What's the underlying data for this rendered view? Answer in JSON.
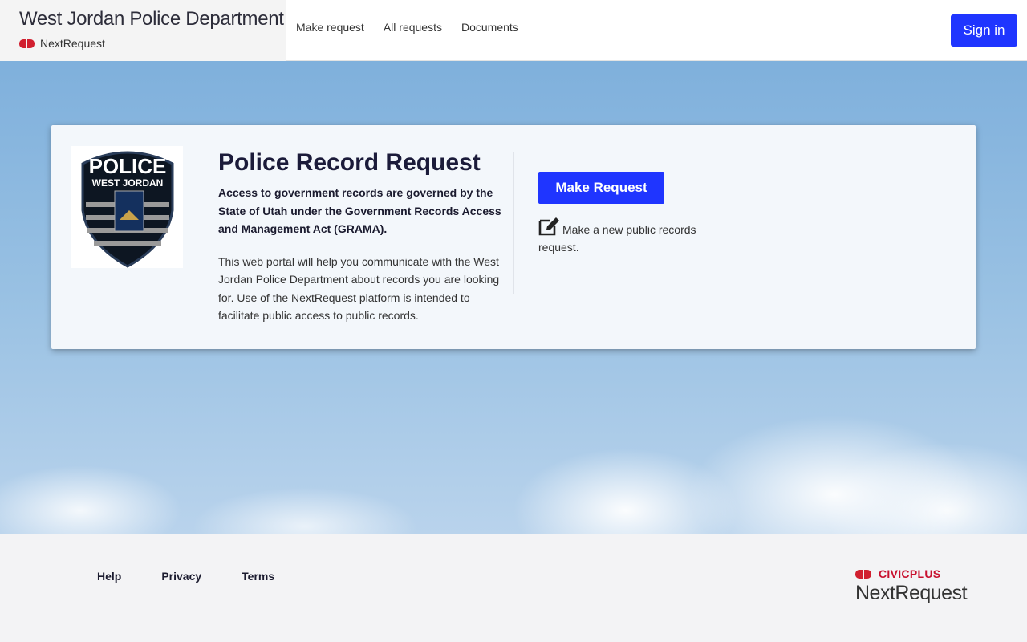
{
  "header": {
    "title": "West Jordan Police Department",
    "platform": "NextRequest",
    "nav": [
      "Make request",
      "All requests",
      "Documents"
    ],
    "sign_in": "Sign in"
  },
  "card": {
    "logo_text": [
      "POLICE",
      "WEST JORDAN"
    ],
    "title": "Police Record Request",
    "bold_text": "Access to government records are governed by the State of Utah under the Government Records Access and Management Act (GRAMA).",
    "description": "This web portal will help you communicate with the West Jordan Police Department about records you are looking for. Use of the NextRequest platform is intended to facilitate public access to public records.",
    "button": "Make Request",
    "button_desc": "Make a new public records request.",
    "icon": "edit-icon"
  },
  "footer": {
    "links": [
      "Help",
      "Privacy",
      "Terms"
    ],
    "brand_top": "CIVICPLUS",
    "brand_bottom": "NextRequest"
  },
  "colors": {
    "primary": "#1f35ff",
    "brand_red": "#d11f2f"
  }
}
